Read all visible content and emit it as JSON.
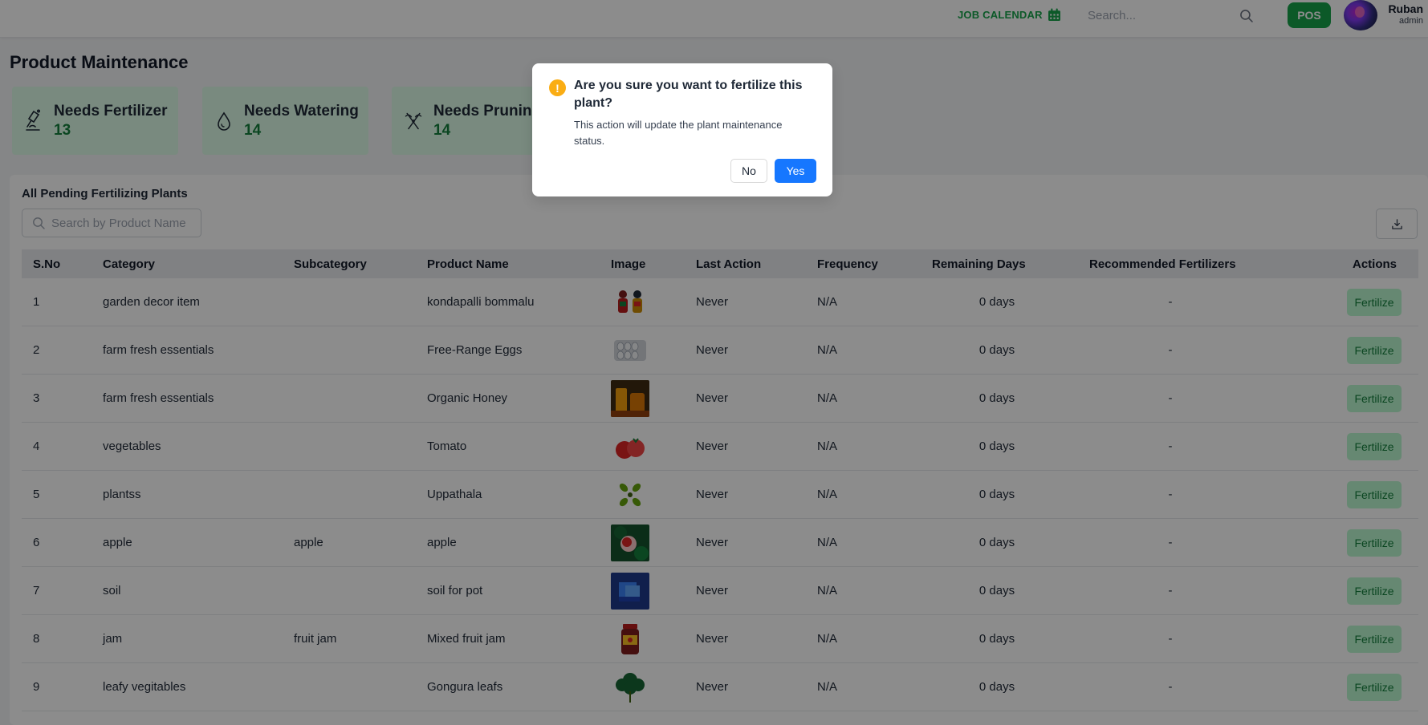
{
  "header": {
    "job_calendar_label": "JOB CALENDAR",
    "search_placeholder": "Search...",
    "pos_label": "POS",
    "user_name": "Ruban",
    "user_role": "admin"
  },
  "page": {
    "title": "Product Maintenance"
  },
  "stats": [
    {
      "label": "Needs Fertilizer",
      "count": "13",
      "icon": "fertilizer-icon"
    },
    {
      "label": "Needs Watering",
      "count": "14",
      "icon": "water-drop-icon"
    },
    {
      "label": "Needs Pruning",
      "count": "14",
      "icon": "pruning-shears-icon"
    }
  ],
  "panel": {
    "title": "All Pending Fertilizing Plants",
    "search_placeholder": "Search by Product Name"
  },
  "table": {
    "headers": {
      "sno": "S.No",
      "category": "Category",
      "subcategory": "Subcategory",
      "product": "Product Name",
      "image": "Image",
      "last_action": "Last Action",
      "frequency": "Frequency",
      "remaining": "Remaining Days",
      "recommended": "Recommended Fertilizers",
      "actions": "Actions"
    },
    "action_label": "Fertilize",
    "rows": [
      {
        "sno": "1",
        "category": "garden decor item",
        "subcategory": "",
        "product": "kondapalli bommalu",
        "last_action": "Never",
        "frequency": "N/A",
        "remaining": "0 days",
        "recommended": "-"
      },
      {
        "sno": "2",
        "category": "farm fresh essentials",
        "subcategory": "",
        "product": "Free-Range Eggs",
        "last_action": "Never",
        "frequency": "N/A",
        "remaining": "0 days",
        "recommended": "-"
      },
      {
        "sno": "3",
        "category": "farm fresh essentials",
        "subcategory": "",
        "product": "Organic Honey",
        "last_action": "Never",
        "frequency": "N/A",
        "remaining": "0 days",
        "recommended": "-"
      },
      {
        "sno": "4",
        "category": "vegetables",
        "subcategory": "",
        "product": "Tomato",
        "last_action": "Never",
        "frequency": "N/A",
        "remaining": "0 days",
        "recommended": "-"
      },
      {
        "sno": "5",
        "category": "plantss",
        "subcategory": "",
        "product": "Uppathala",
        "last_action": "Never",
        "frequency": "N/A",
        "remaining": "0 days",
        "recommended": "-"
      },
      {
        "sno": "6",
        "category": "apple",
        "subcategory": "apple",
        "product": "apple",
        "last_action": "Never",
        "frequency": "N/A",
        "remaining": "0 days",
        "recommended": "-"
      },
      {
        "sno": "7",
        "category": "soil",
        "subcategory": "",
        "product": "soil for pot",
        "last_action": "Never",
        "frequency": "N/A",
        "remaining": "0 days",
        "recommended": "-"
      },
      {
        "sno": "8",
        "category": "jam",
        "subcategory": "fruit jam",
        "product": "Mixed fruit jam",
        "last_action": "Never",
        "frequency": "N/A",
        "remaining": "0 days",
        "recommended": "-"
      },
      {
        "sno": "9",
        "category": "leafy vegitables",
        "subcategory": "",
        "product": "Gongura leafs",
        "last_action": "Never",
        "frequency": "N/A",
        "remaining": "0 days",
        "recommended": "-"
      }
    ]
  },
  "modal": {
    "title": "Are you sure you want to fertilize this plant?",
    "body": "This action will update the plant maintenance status.",
    "no_label": "No",
    "yes_label": "Yes",
    "icon": "warning-icon"
  },
  "colors": {
    "brand_green": "#16a34a",
    "card_bg": "#dcfce7",
    "primary_blue": "#1677ff",
    "warning": "#faad14"
  }
}
